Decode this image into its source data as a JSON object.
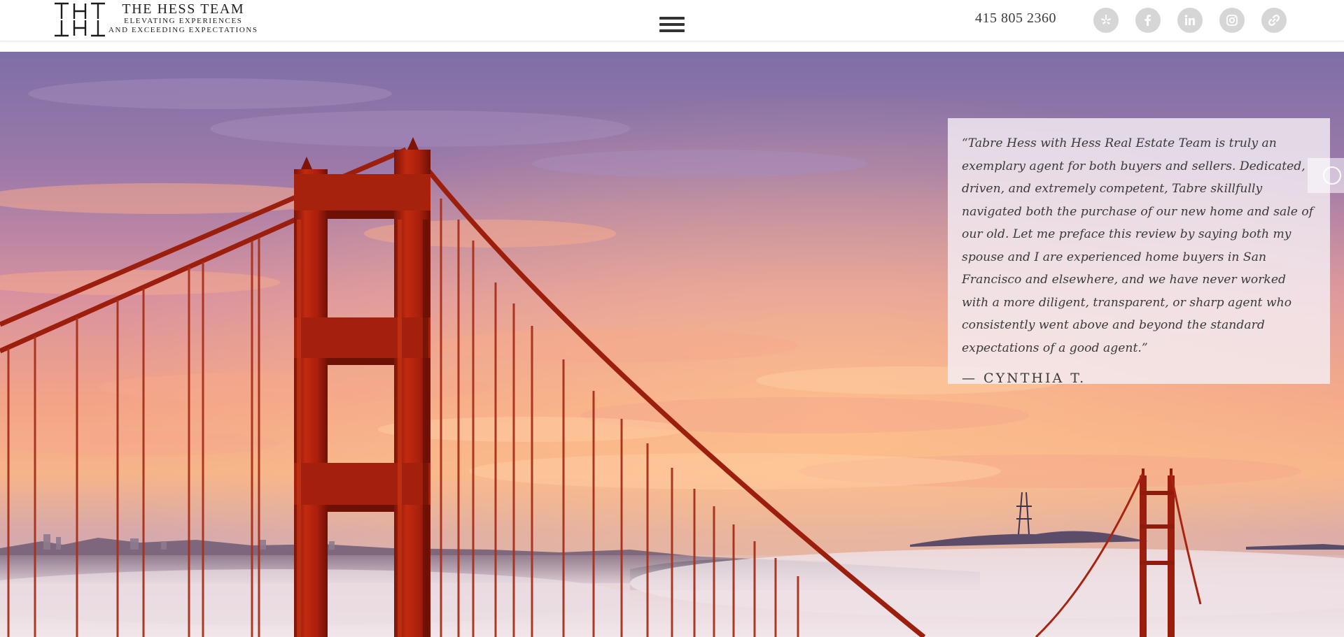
{
  "header": {
    "brand": {
      "title": "THE HESS TEAM",
      "tagline_1": "ELEVATING EXPERIENCES",
      "tagline_2": "AND EXCEEDING EXPECTATIONS"
    },
    "phone": "415 805 2360",
    "social_icons": [
      "yelp-icon",
      "facebook-icon",
      "linkedin-icon",
      "instagram-icon",
      "link-icon"
    ]
  },
  "testimonial": {
    "quote": "“Tabre Hess with Hess Real Estate Team is truly an exemplary agent for both buyers and sellers. Dedicated, driven, and extremely competent, Tabre skillfully navigated both the purchase of our new home and sale of our old. Let me preface this review by saying both my spouse and I are experienced home buyers in San Francisco and elsewhere, and we have never worked with a more diligent, transparent, or sharp agent who consistently went above and beyond the standard expectations of a good agent.”",
    "author": "— CYNTHIA T."
  },
  "colors": {
    "header_bg": "#ffffff",
    "bridge_red": "#b8260f",
    "social_bg": "#d6d6d6",
    "text_dark": "#3a3a3a"
  }
}
